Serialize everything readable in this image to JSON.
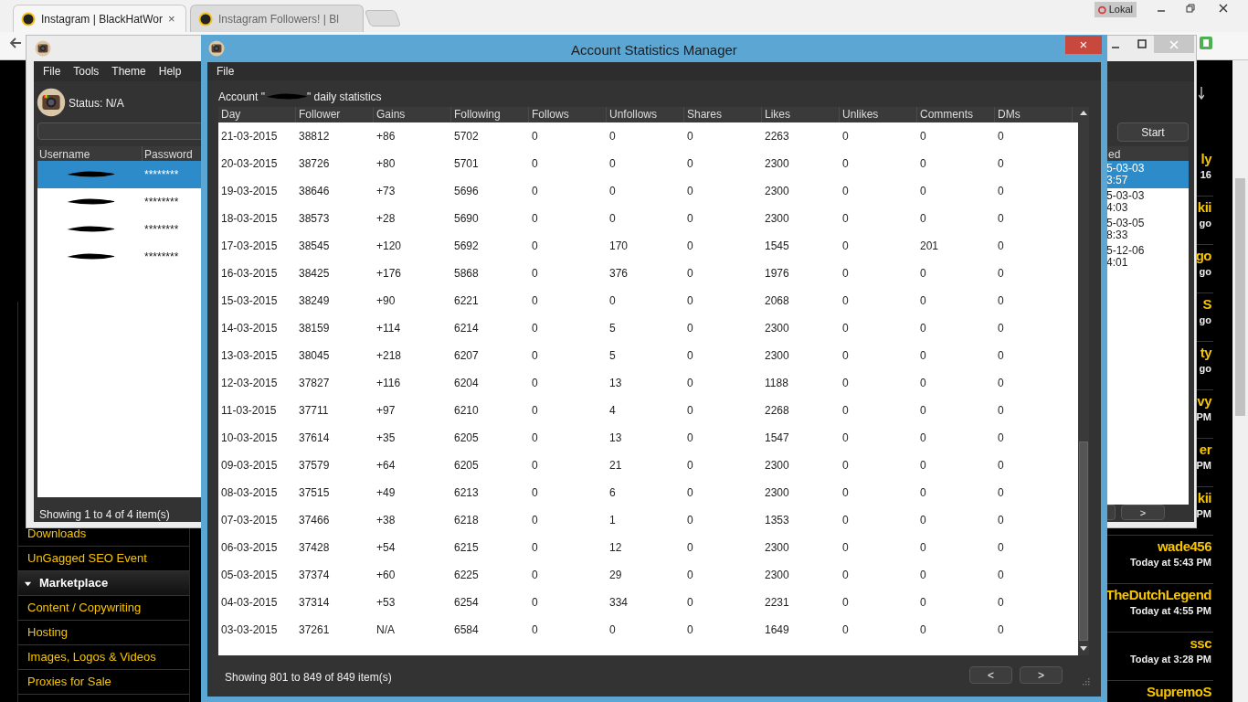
{
  "browser": {
    "tabs": [
      {
        "label": "Instagram | BlackHatWor",
        "selected": true
      },
      {
        "label": "Instagram Followers! | Bl",
        "selected": false
      }
    ],
    "close_glyph": "×",
    "profile": "Lokal"
  },
  "forum": {
    "sidebar": [
      {
        "kind": "link",
        "label": "Downloads"
      },
      {
        "kind": "link",
        "label": "UnGagged SEO Event"
      },
      {
        "kind": "header",
        "label": "Marketplace",
        "expanded": true
      },
      {
        "kind": "link",
        "label": "Content / Copywriting"
      },
      {
        "kind": "link",
        "label": "Hosting"
      },
      {
        "kind": "link",
        "label": "Images, Logos & Videos"
      },
      {
        "kind": "link",
        "label": "Proxies for Sale"
      }
    ],
    "posters": [
      {
        "name": "ly",
        "time": "16"
      },
      {
        "name": "kii",
        "time": "go"
      },
      {
        "name": "go",
        "time": "go"
      },
      {
        "name": "S",
        "time": "go"
      },
      {
        "name": "ty",
        "time": "go"
      },
      {
        "name": "vy",
        "time": "PM"
      },
      {
        "name": "er",
        "time": "PM"
      },
      {
        "name": "kii",
        "time": "PM"
      },
      {
        "name": "wade456",
        "time": "Today at 5:43 PM"
      },
      {
        "name": "TheDutchLegend",
        "time": "Today at 4:55 PM"
      },
      {
        "name": "ssc",
        "time": "Today at 3:28 PM"
      },
      {
        "name": "SupremoS"
      }
    ]
  },
  "bot_window": {
    "menu": [
      "File",
      "Tools",
      "Theme",
      "Help"
    ],
    "status": "Status: N/A",
    "columns": [
      "Username",
      "Password"
    ],
    "cut_column": "ed",
    "accounts": [
      {
        "password": "********",
        "date": "5-03-03",
        "time": "3:57",
        "selected": true
      },
      {
        "password": "********",
        "date": "5-03-03",
        "time": "4:03",
        "selected": false
      },
      {
        "password": "********",
        "date": "5-03-05",
        "time": "8:33",
        "selected": false
      },
      {
        "password": "********",
        "date": "5-12-06",
        "time": "4:01",
        "selected": false
      }
    ],
    "start": "Start",
    "footer": "Showing 1 to 4 of 4 item(s)",
    "next": ">"
  },
  "stats_window": {
    "title": "Account Statistics Manager",
    "close": "×",
    "menu": [
      "File"
    ],
    "caption_before": "Account \"",
    "caption_after": "\" daily statistics",
    "columns": [
      "Day",
      "Follower",
      "Gains",
      "Following",
      "Follows",
      "Unfollows",
      "Shares",
      "Likes",
      "Unlikes",
      "Comments",
      "DMs"
    ],
    "rows": [
      [
        "21-03-2015",
        "38812",
        "+86",
        "5702",
        "0",
        "0",
        "0",
        "2263",
        "0",
        "0",
        "0"
      ],
      [
        "20-03-2015",
        "38726",
        "+80",
        "5701",
        "0",
        "0",
        "0",
        "2300",
        "0",
        "0",
        "0"
      ],
      [
        "19-03-2015",
        "38646",
        "+73",
        "5696",
        "0",
        "0",
        "0",
        "2300",
        "0",
        "0",
        "0"
      ],
      [
        "18-03-2015",
        "38573",
        "+28",
        "5690",
        "0",
        "0",
        "0",
        "2300",
        "0",
        "0",
        "0"
      ],
      [
        "17-03-2015",
        "38545",
        "+120",
        "5692",
        "0",
        "170",
        "0",
        "1545",
        "0",
        "201",
        "0"
      ],
      [
        "16-03-2015",
        "38425",
        "+176",
        "5868",
        "0",
        "376",
        "0",
        "1976",
        "0",
        "0",
        "0"
      ],
      [
        "15-03-2015",
        "38249",
        "+90",
        "6221",
        "0",
        "0",
        "0",
        "2068",
        "0",
        "0",
        "0"
      ],
      [
        "14-03-2015",
        "38159",
        "+114",
        "6214",
        "0",
        "5",
        "0",
        "2300",
        "0",
        "0",
        "0"
      ],
      [
        "13-03-2015",
        "38045",
        "+218",
        "6207",
        "0",
        "5",
        "0",
        "2300",
        "0",
        "0",
        "0"
      ],
      [
        "12-03-2015",
        "37827",
        "+116",
        "6204",
        "0",
        "13",
        "0",
        "1188",
        "0",
        "0",
        "0"
      ],
      [
        "11-03-2015",
        "37711",
        "+97",
        "6210",
        "0",
        "4",
        "0",
        "2268",
        "0",
        "0",
        "0"
      ],
      [
        "10-03-2015",
        "37614",
        "+35",
        "6205",
        "0",
        "13",
        "0",
        "1547",
        "0",
        "0",
        "0"
      ],
      [
        "09-03-2015",
        "37579",
        "+64",
        "6205",
        "0",
        "21",
        "0",
        "2300",
        "0",
        "0",
        "0"
      ],
      [
        "08-03-2015",
        "37515",
        "+49",
        "6213",
        "0",
        "6",
        "0",
        "2300",
        "0",
        "0",
        "0"
      ],
      [
        "07-03-2015",
        "37466",
        "+38",
        "6218",
        "0",
        "1",
        "0",
        "1353",
        "0",
        "0",
        "0"
      ],
      [
        "06-03-2015",
        "37428",
        "+54",
        "6215",
        "0",
        "12",
        "0",
        "2300",
        "0",
        "0",
        "0"
      ],
      [
        "05-03-2015",
        "37374",
        "+60",
        "6225",
        "0",
        "29",
        "0",
        "2300",
        "0",
        "0",
        "0"
      ],
      [
        "04-03-2015",
        "37314",
        "+53",
        "6254",
        "0",
        "334",
        "0",
        "2231",
        "0",
        "0",
        "0"
      ],
      [
        "03-03-2015",
        "37261",
        "N/A",
        "6584",
        "0",
        "0",
        "0",
        "1649",
        "0",
        "0",
        "0"
      ]
    ],
    "footer": "Showing 801 to 849 of 849 item(s)",
    "prev": "<",
    "next": ">"
  }
}
